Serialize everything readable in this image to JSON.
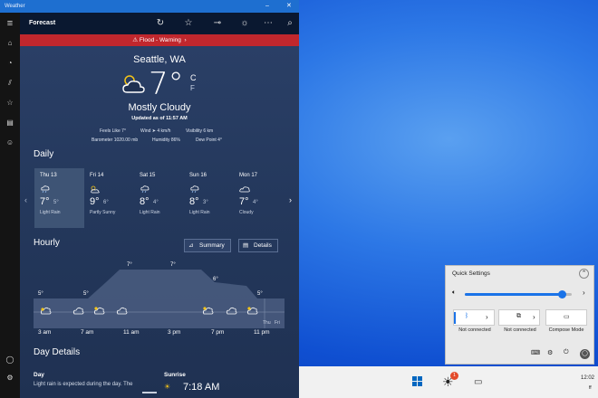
{
  "window": {
    "title": "Weather"
  },
  "appbar": {
    "title": "Forecast"
  },
  "alert": {
    "text": "Flood - Warning"
  },
  "current": {
    "city": "Seattle, WA",
    "temp": "7°",
    "unit_c": "C",
    "unit_f": "F",
    "condition": "Mostly Cloudy",
    "updated": "Updated as of 11:57 AM",
    "feels_like": "Feels Like  7°",
    "wind": "Wind  ➤ 4 km/h",
    "visibility": "Visibility  6 km",
    "barometer": "Barometer  1020.00 mb",
    "humidity": "Humidity  86%",
    "dew_point": "Dew Point  4°"
  },
  "daily": {
    "title": "Daily",
    "days": [
      {
        "day": "Thu 13",
        "hi": "7°",
        "lo": "5°",
        "cond": "Light Rain"
      },
      {
        "day": "Fri 14",
        "hi": "9°",
        "lo": "6°",
        "cond": "Partly Sunny"
      },
      {
        "day": "Sat 15",
        "hi": "8°",
        "lo": "4°",
        "cond": "Light Rain"
      },
      {
        "day": "Sun 16",
        "hi": "8°",
        "lo": "3°",
        "cond": "Light Rain"
      },
      {
        "day": "Mon 17",
        "hi": "7°",
        "lo": "4°",
        "cond": "Cloudy"
      }
    ]
  },
  "hourly": {
    "title": "Hourly",
    "summary_label": "Summary",
    "details_label": "Details",
    "temps": [
      "5°",
      "5°",
      "7°",
      "7°",
      "6°",
      "5°"
    ],
    "day_labels": [
      "Thu",
      "Fri"
    ],
    "times": [
      "3 am",
      "7 am",
      "11 am",
      "3 pm",
      "7 pm",
      "11 pm"
    ]
  },
  "day_details": {
    "title": "Day Details",
    "day_label": "Day",
    "text": "Light rain is expected during the day. The",
    "sunrise_label": "Sunrise",
    "sunrise_value": "7:18 AM"
  },
  "quick_settings": {
    "title": "Quick Settings",
    "tile1_status": "Not connected",
    "tile2_status": "Not connected",
    "tile3_label": "Compose Mode",
    "volume": 0.91
  },
  "taskbar": {
    "time": "12:02",
    "date_short": "ff",
    "badge": "1"
  }
}
